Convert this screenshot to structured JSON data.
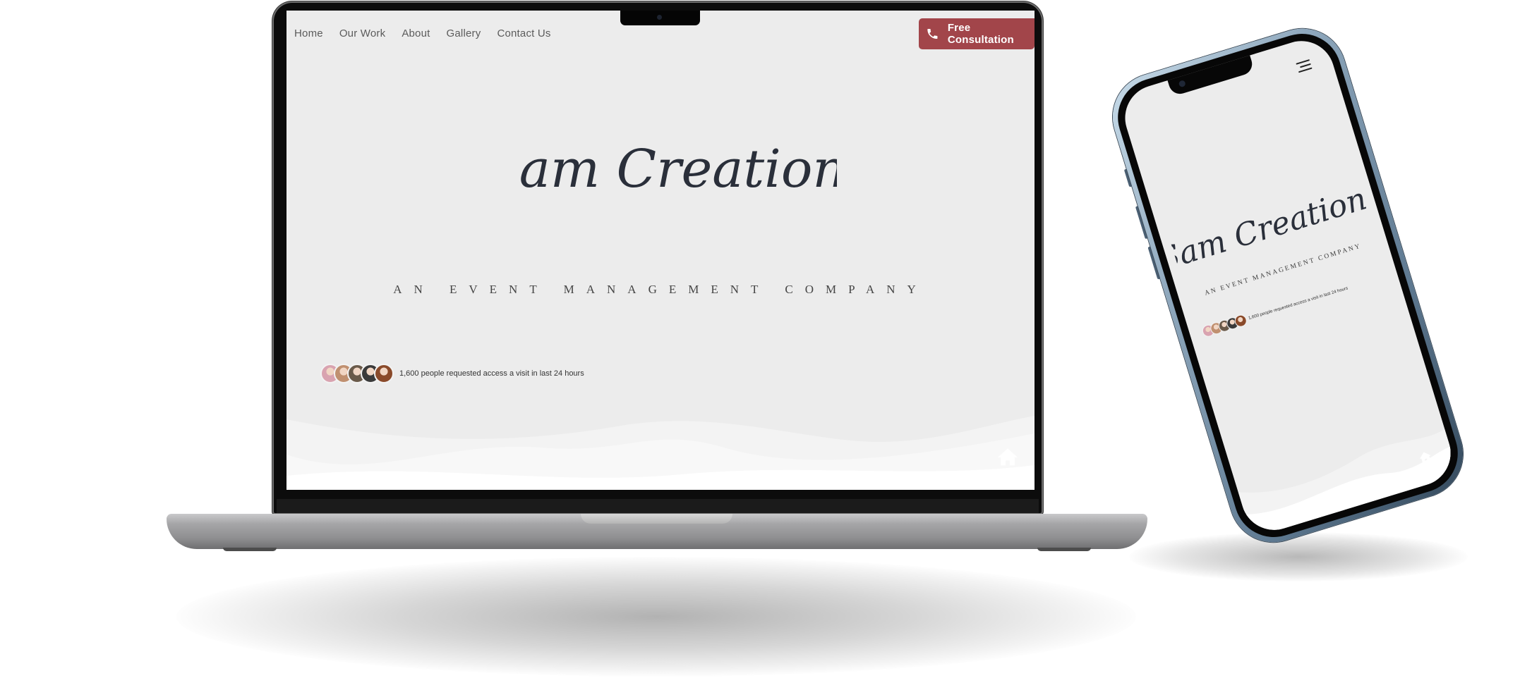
{
  "nav": {
    "items": [
      {
        "label": "Home"
      },
      {
        "label": "Our Work"
      },
      {
        "label": "About"
      },
      {
        "label": "Gallery"
      },
      {
        "label": "Contact Us"
      }
    ]
  },
  "cta": {
    "label": "Free Consultation",
    "icon": "phone-icon",
    "color": "#a2454a"
  },
  "hero": {
    "brand": "Sam Creations",
    "tagline": "AN EVENT MANAGEMENT COMPANY",
    "social_proof": "1,600 people requested access a visit in last 24 hours",
    "avatar_colors": [
      "#d9a3b0",
      "#c09070",
      "#6a5a4a",
      "#3a3a3a",
      "#8a4a2a"
    ]
  },
  "colors": {
    "page_bg": "#ececec",
    "text": "#333333",
    "brand_script": "#2a2f3a"
  },
  "icons": {
    "home": "home-icon",
    "menu": "hamburger-menu-icon"
  }
}
